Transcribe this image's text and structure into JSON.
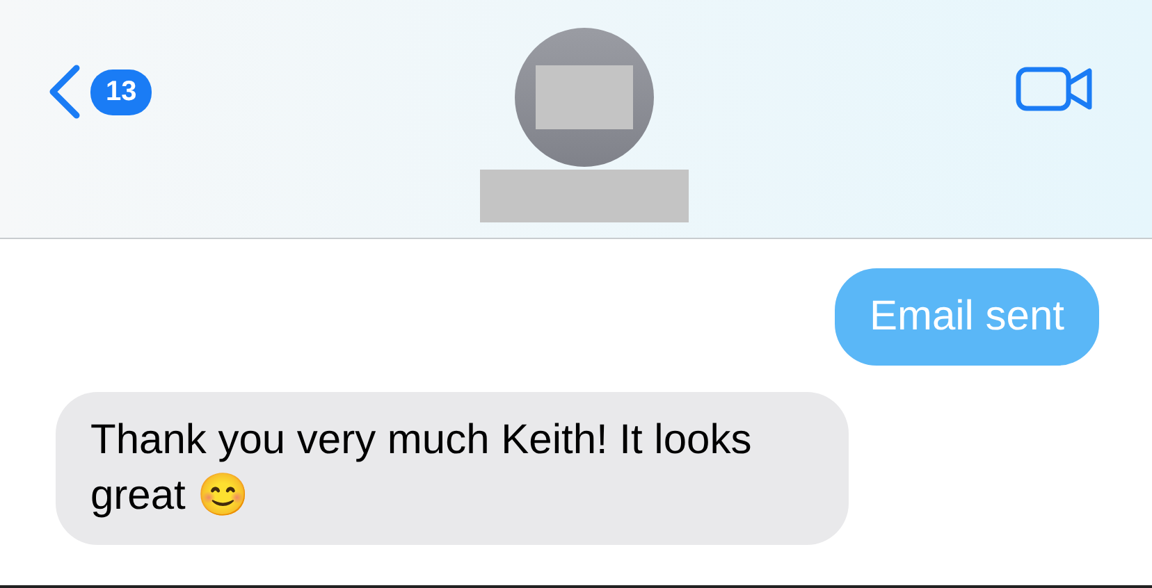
{
  "header": {
    "back_badge": "13",
    "contact": {
      "redacted": true
    }
  },
  "messages": [
    {
      "kind": "sent",
      "text": "Email sent"
    },
    {
      "kind": "received",
      "text": "Thank you very much Keith! It looks great 😊"
    }
  ]
}
